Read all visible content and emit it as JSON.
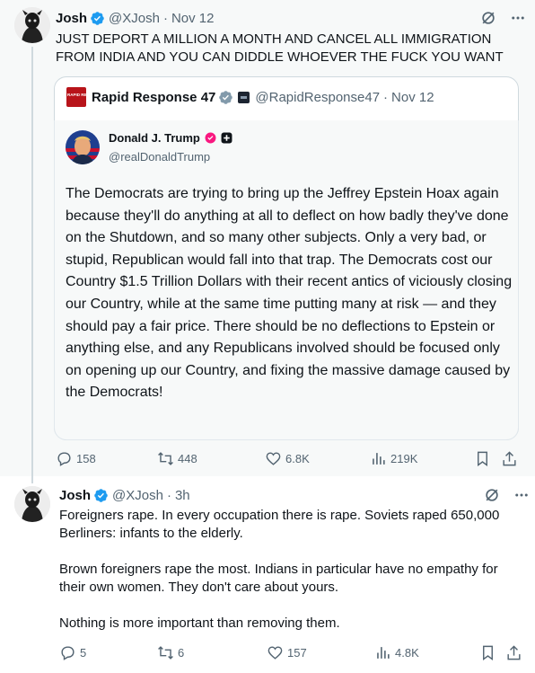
{
  "post1": {
    "author_name": "Josh",
    "handle": "@XJosh",
    "sep": "·",
    "date": "Nov 12",
    "text": "JUST DEPORT A MILLION A MONTH AND CANCEL ALL IMMIGRATION FROM INDIA AND YOU CAN DIDDLE WHOEVER THE FUCK YOU WANT",
    "quote": {
      "logo_text": "RAPID RESPONSE",
      "author_name": "Rapid Response 47",
      "handle": "@RapidResponse47",
      "sep": "·",
      "date": "Nov 12",
      "inner": {
        "author_name": "Donald J. Trump",
        "handle": "@realDonaldTrump",
        "text": "The Democrats are trying to bring up the Jeffrey Epstein Hoax again because they'll do anything at all to deflect on how badly they've done on the Shutdown, and so many other subjects. Only a very bad, or stupid, Republican would fall into that trap. The Democrats cost our Country $1.5 Trillion Dollars with their recent antics of viciously closing our Country, while at the same time putting many at risk — and they should pay a fair price. There should be no deflections to Epstein or anything else, and any Republicans involved should be focused only on opening up our Country, and fixing the massive damage caused by the Democrats!"
      }
    },
    "stats": {
      "replies": "158",
      "reposts": "448",
      "likes": "6.8K",
      "views": "219K"
    }
  },
  "post2": {
    "author_name": "Josh",
    "handle": "@XJosh",
    "sep": "·",
    "date": "3h",
    "text": "Foreigners rape. In every occupation there is rape. Soviets raped 650,000 Berliners: infants to the elderly.\n\nBrown foreigners rape the most. Indians in particular have no empathy for their own women. They don't care about yours.\n\nNothing is more important than removing them.",
    "stats": {
      "replies": "5",
      "reposts": "6",
      "likes": "157",
      "views": "4.8K"
    }
  },
  "colors": {
    "verified_blue": "#1d9bf0",
    "secondary_text": "#536471",
    "border": "#cfd9de",
    "pink_badge": "#f91880"
  }
}
